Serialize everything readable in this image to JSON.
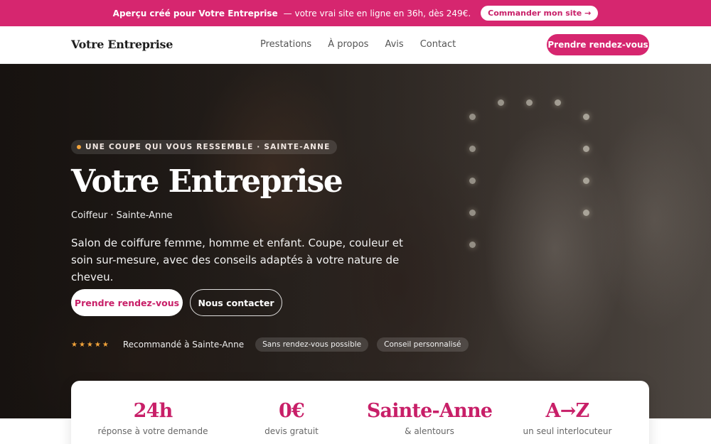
{
  "promo": {
    "lead": "Aperçu créé pour Votre Entreprise",
    "text": "— votre vrai site en ligne en 36h, dès 249€.",
    "button": "Commander mon site →"
  },
  "header": {
    "brand": "Votre Entreprise",
    "nav": [
      "Prestations",
      "À propos",
      "Avis",
      "Contact"
    ],
    "cta": "Prendre rendez-vous"
  },
  "hero": {
    "eyebrow": "UNE COUPE QUI VOUS RESSEMBLE · SAINTE-ANNE",
    "title": "Votre Entreprise",
    "subtitle": "Coiffeur · Sainte-Anne",
    "description": "Salon de coiffure femme, homme et enfant. Coupe, couleur et soin sur-mesure, avec des conseils adaptés à votre nature de cheveu.",
    "primary_button": "Prendre rendez-vous",
    "secondary_button": "Nous contacter",
    "stars": "★★★★★",
    "rating_text": "Recommandé à Sainte-Anne",
    "pills": [
      "Sans rendez-vous possible",
      "Conseil personnalisé"
    ]
  },
  "stats": [
    {
      "value": "24h",
      "label": "réponse à votre demande"
    },
    {
      "value": "0€",
      "label": "devis gratuit"
    },
    {
      "value": "Sainte-Anne",
      "label": "& alentours"
    },
    {
      "value": "A→Z",
      "label": "un seul interlocuteur"
    }
  ],
  "colors": {
    "accent": "#d6266f",
    "accent_text": "#c81f68",
    "star": "#f2a33a"
  }
}
